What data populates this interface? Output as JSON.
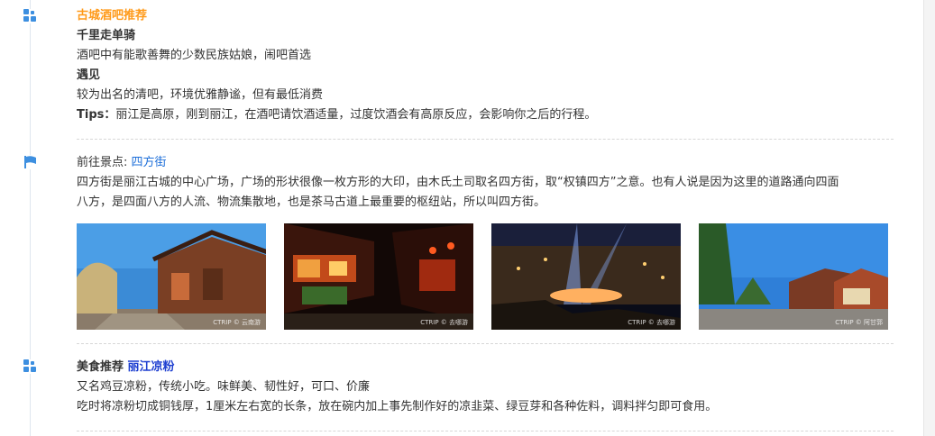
{
  "bar_section": {
    "title": "古城酒吧推荐",
    "items": [
      {
        "name": "千里走单骑",
        "desc": "酒吧中有能歌善舞的少数民族姑娘，闹吧首选"
      },
      {
        "name": "遇见",
        "desc": "较为出名的清吧，环境优雅静谧，但有最低消费"
      }
    ],
    "tips_label": "Tips：",
    "tips_text": "丽江是高原，刚到丽江，在酒吧请饮酒适量，过度饮酒会有高原反应，会影响你之后的行程。"
  },
  "spot_section": {
    "prefix": "前往景点: ",
    "spot_name": "四方街",
    "desc_line1": "四方街是丽江古城的中心广场，广场的形状很像一枚方形的大印，由木氏土司取名四方街，取“权镇四方”之意。也有人说是因为这里的道路通向四面",
    "desc_line2": "八方，是四面八方的人流、物流集散地，也是茶马古道上最重要的枢纽站，所以叫四方街。",
    "photos": [
      {
        "credit": "CTRIP © 云南游"
      },
      {
        "credit": "CTRIP © 去哪游"
      },
      {
        "credit": "CTRIP © 去哪游"
      },
      {
        "credit": "CTRIP © 阿甘郭"
      }
    ]
  },
  "food_section": {
    "label": "美食推荐 ",
    "dish": "丽江凉粉",
    "line1": "又名鸡豆凉粉，传统小吃。味鲜美、韧性好，可口、价廉",
    "line2": "吃时将凉粉切成铜钱厚，1厘米左右宽的长条，放在碗内加上事先制作好的凉韭菜、绿豆芽和各种佐料，调料拌匀即可食用。"
  },
  "colors": {
    "accent_orange": "#ff9a1a",
    "link_blue": "#1e6fd9",
    "icon_blue": "#3d8fe0"
  }
}
